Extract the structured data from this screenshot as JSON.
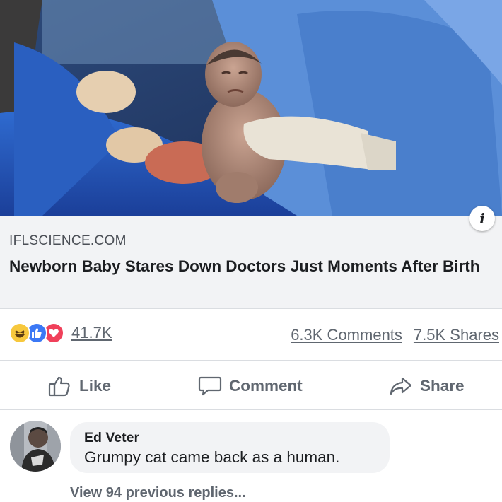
{
  "post": {
    "image_alt": "Newborn baby held by doctors in blue surgical scrubs",
    "link": {
      "domain": "IFLSCIENCE.COM",
      "title": "Newborn Baby Stares Down Doctors Just Moments After Birth"
    },
    "info_button_glyph": "i",
    "stats": {
      "reaction_icons": [
        "haha-icon",
        "like-icon",
        "love-icon"
      ],
      "reaction_count": "41.7K",
      "comments": "6.3K Comments",
      "shares": "7.5K Shares"
    },
    "actions": [
      {
        "label": "Like",
        "icon": "thumbs-up-icon"
      },
      {
        "label": "Comment",
        "icon": "speech-bubble-icon"
      },
      {
        "label": "Share",
        "icon": "share-arrow-icon"
      }
    ]
  },
  "comment": {
    "author": "Ed Veter",
    "text": "Grumpy cat came back as a human."
  },
  "view_previous": "View 94 previous replies...",
  "colors": {
    "text_primary": "#1c1e21",
    "text_secondary": "#606770",
    "link_box_bg": "#f2f3f5",
    "divider": "#dadde1",
    "like_blue": "#3b78f5",
    "love_red": "#f0405a",
    "haha_yellow": "#f7c83d"
  }
}
